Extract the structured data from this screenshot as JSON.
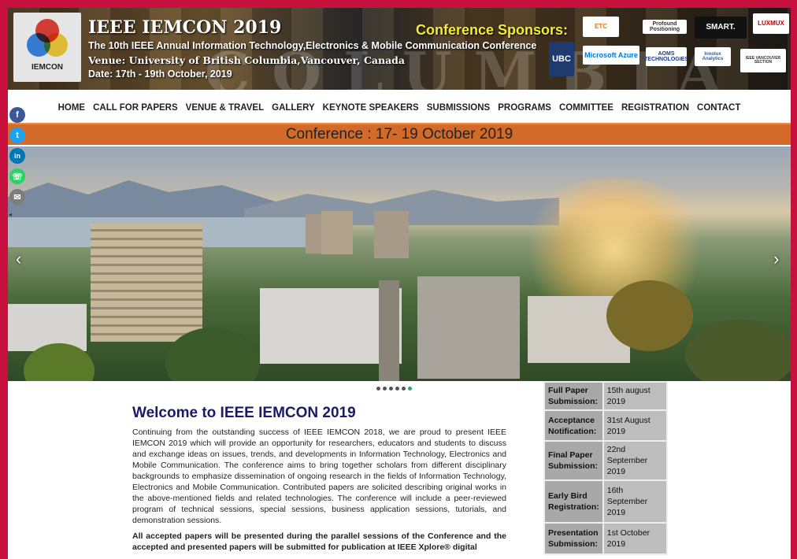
{
  "header": {
    "logo_text": "IEMCON",
    "title": "IEEE IEMCON 2019",
    "subtitle": "The 10th IEEE Annual Information Technology,Electronics & Mobile Communication Conference",
    "venue": "Venue: University of British Columbia,Vancouver, Canada",
    "date": "Date:  17th - 19th October, 2019",
    "sponsors_title": "Conference Sponsors:",
    "sponsors": [
      "ETC",
      "Profound Positioning",
      "SMART.",
      "LUXMUX",
      "UBC",
      "Microsoft Azure",
      "AOMS TECHNOLOGIES",
      "Innolux Analytics",
      "IEEE VANCOUVER SECTION"
    ]
  },
  "nav": [
    "HOME",
    "CALL FOR PAPERS",
    "VENUE & TRAVEL",
    "GALLERY",
    "KEYNOTE SPEAKERS",
    "SUBMISSIONS",
    "PROGRAMS",
    "COMMITTEE",
    "REGISTRATION",
    "CONTACT"
  ],
  "banner": "Conference : 17- 19 October 2019",
  "share": [
    {
      "icon": "facebook-icon",
      "glyph": "f",
      "color": "#3b5998"
    },
    {
      "icon": "twitter-icon",
      "glyph": "t",
      "color": "#1da1f2"
    },
    {
      "icon": "linkedin-icon",
      "glyph": "in",
      "color": "#0077b5"
    },
    {
      "icon": "whatsapp-icon",
      "glyph": "☏",
      "color": "#25d366"
    },
    {
      "icon": "email-icon",
      "glyph": "✉",
      "color": "#7d7d7d"
    }
  ],
  "slider": {
    "prev": "‹",
    "next": "›",
    "slides": 6,
    "active": 6
  },
  "welcome": {
    "title": "Welcome to IEEE IEMCON 2019",
    "body": "Continuing from the outstanding success of IEEE IEMCON 2018, we are proud to present IEEE IEMCON 2019 which will provide an opportunity for researchers, educators and students to discuss and exchange ideas on issues, trends, and developments in Information Technology, Electronics and Mobile Communication. The conference aims to bring together scholars from different disciplinary backgrounds to emphasize dissemination of ongoing research in the fields of Information Technology, Electronics and Mobile Communication. Contributed papers are solicited describing original works in the above-mentioned fields and related technologies. The conference will include a peer-reviewed program of technical sessions, special sessions, business application sessions, tutorials, and demonstration sessions.",
    "bold": "All accepted papers will be presented during the parallel sessions of the Conference and the accepted and presented papers will be submitted for publication at IEEE Xplore® digital"
  },
  "dates": [
    {
      "label": "Full Paper Submission:",
      "value": "15th august 2019"
    },
    {
      "label": "Acceptance Notification:",
      "value": "31st August 2019"
    },
    {
      "label": "Final Paper Submission:",
      "value": "22nd September 2019"
    },
    {
      "label": "Early Bird Registration:",
      "value": "16th September 2019"
    },
    {
      "label": "Presentation Submission:",
      "value": "1st October 2019"
    }
  ]
}
